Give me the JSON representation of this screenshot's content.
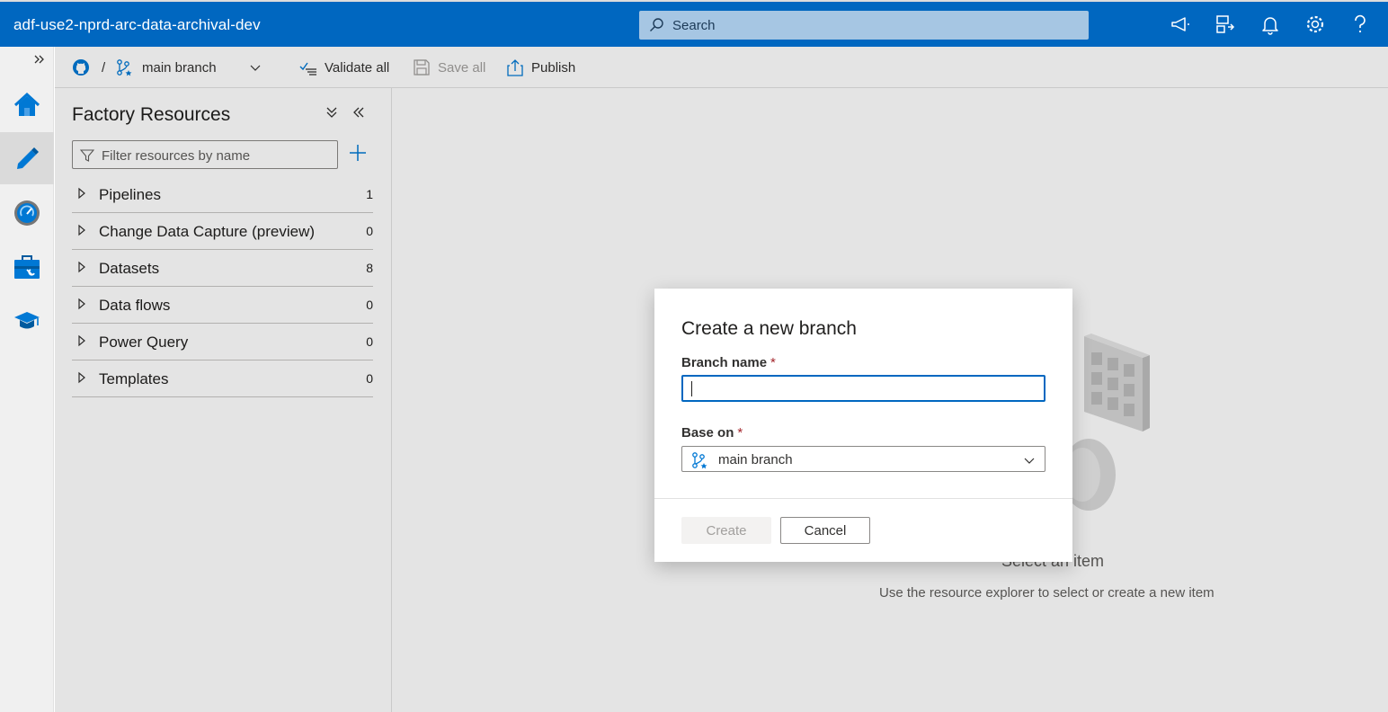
{
  "header": {
    "title": "adf-use2-nprd-arc-data-archival-dev",
    "search_placeholder": "Search",
    "icons": [
      "announcement-icon",
      "directory-switch-icon",
      "notification-bell-icon",
      "settings-gear-icon",
      "help-icon"
    ]
  },
  "rail": {
    "expand_icon": "double-chevron-right-icon",
    "items": [
      {
        "name": "home",
        "icon": "home-icon",
        "active": false
      },
      {
        "name": "author",
        "icon": "pencil-icon",
        "active": true
      },
      {
        "name": "monitor",
        "icon": "gauge-icon",
        "active": false
      },
      {
        "name": "manage",
        "icon": "toolbox-icon",
        "active": false
      },
      {
        "name": "learning",
        "icon": "graduation-cap-icon",
        "active": false
      }
    ]
  },
  "toolbar": {
    "repo_separator": "/",
    "branch": "main branch",
    "validate_all": "Validate all",
    "save_all": "Save all",
    "publish": "Publish"
  },
  "resources": {
    "title": "Factory Resources",
    "filter_placeholder": "Filter resources by name",
    "items": [
      {
        "label": "Pipelines",
        "count": "1"
      },
      {
        "label": "Change Data Capture (preview)",
        "count": "0"
      },
      {
        "label": "Datasets",
        "count": "8"
      },
      {
        "label": "Data flows",
        "count": "0"
      },
      {
        "label": "Power Query",
        "count": "0"
      },
      {
        "label": "Templates",
        "count": "0"
      }
    ]
  },
  "canvas": {
    "empty_title": "Select an item",
    "empty_subtitle": "Use the resource explorer to select or create a new item"
  },
  "dialog": {
    "title": "Create a new branch",
    "branch_name_label": "Branch name",
    "branch_name_value": "",
    "required_marker": "*",
    "base_on_label": "Base on",
    "base_on_value": "main branch",
    "create_label": "Create",
    "cancel_label": "Cancel"
  },
  "colors": {
    "brand_blue": "#0067c0",
    "required_red": "#a4262c"
  }
}
